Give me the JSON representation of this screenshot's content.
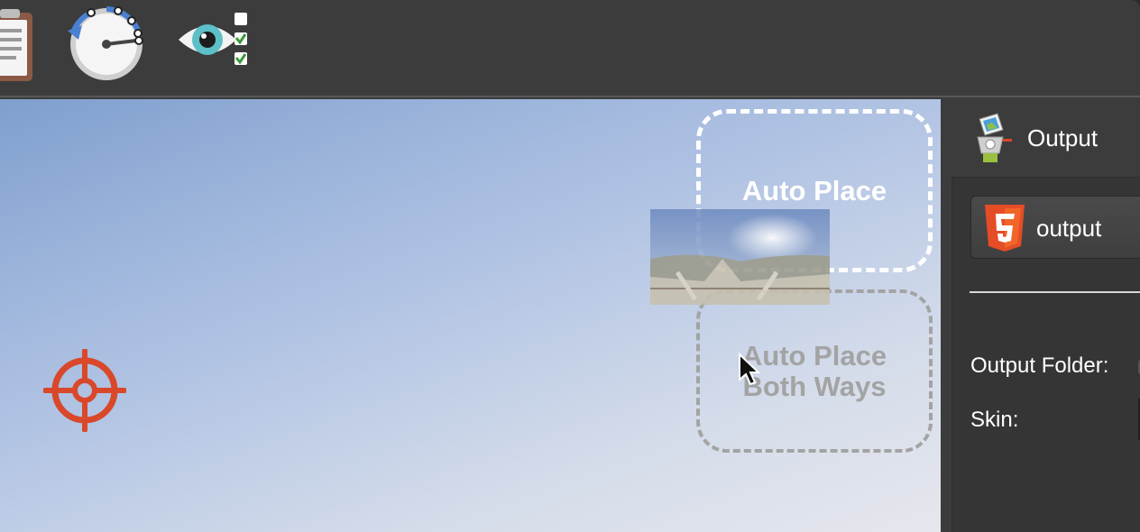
{
  "toolbar": {
    "tools": [
      {
        "name": "clipboard-icon"
      },
      {
        "name": "tour-timer-icon"
      },
      {
        "name": "preview-checklist-icon"
      }
    ]
  },
  "viewer": {
    "drop_zones": {
      "auto_place": "Auto Place",
      "auto_place_both_line1": "Auto Place",
      "auto_place_both_line2": "Both Ways"
    },
    "target_icon": "crosshair-icon",
    "cursor_icon": "arrow-cursor-icon",
    "accent_target": "#d9482a"
  },
  "panel": {
    "title": "Output",
    "output_select": {
      "label": "output",
      "icon": "html5-icon",
      "icon_color": "#e44d26"
    },
    "fields": {
      "output_folder": "Output Folder:",
      "skin": "Skin:"
    }
  }
}
